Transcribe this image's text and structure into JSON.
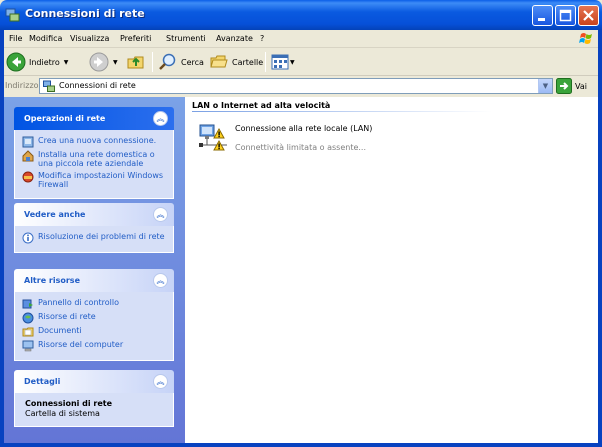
{
  "window": {
    "title": "Connessioni di rete"
  },
  "menu": [
    {
      "label": "File"
    },
    {
      "label": "Modifica"
    },
    {
      "label": "Visualizza"
    },
    {
      "label": "Preferiti"
    },
    {
      "label": "Strumenti"
    },
    {
      "label": "Avanzate"
    },
    {
      "label": "?"
    }
  ],
  "toolbar": {
    "back_label": "Indietro",
    "search_label": "Cerca",
    "folders_label": "Cartelle"
  },
  "address": {
    "label": "Indirizzo",
    "value": "Connessioni di rete",
    "go_label": "Vai"
  },
  "taskpane": {
    "network_tasks": {
      "title": "Operazioni di rete",
      "items": [
        {
          "label": "Crea una nuova connessione.",
          "icon": "new-connection-icon"
        },
        {
          "label": "Installa una rete domestica o una piccola rete aziendale",
          "icon": "home-network-icon"
        },
        {
          "label": "Modifica impostazioni Windows Firewall",
          "icon": "firewall-icon"
        }
      ]
    },
    "see_also": {
      "title": "Vedere anche",
      "items": [
        {
          "label": "Risoluzione dei problemi di rete",
          "icon": "help-icon"
        }
      ]
    },
    "other_places": {
      "title": "Altre risorse",
      "items": [
        {
          "label": "Pannello di controllo",
          "icon": "control-panel-icon"
        },
        {
          "label": "Risorse di rete",
          "icon": "network-places-icon"
        },
        {
          "label": "Documenti",
          "icon": "documents-folder-icon"
        },
        {
          "label": "Risorse del computer",
          "icon": "my-computer-icon"
        }
      ]
    },
    "details": {
      "title": "Dettagli",
      "name": "Connessioni di rete",
      "type": "Cartella di sistema"
    }
  },
  "content": {
    "group_title": "LAN o Internet ad alta velocità",
    "connections": [
      {
        "name": "Connessione alla rete locale (LAN)",
        "status": "Connettività limitata o assente...",
        "icon": "lan-warning-icon"
      }
    ]
  },
  "colors": {
    "titlebar_blue": "#0a5ae0",
    "taskpane_link": "#215dc6",
    "taskpane_bg": "#6375d6"
  }
}
